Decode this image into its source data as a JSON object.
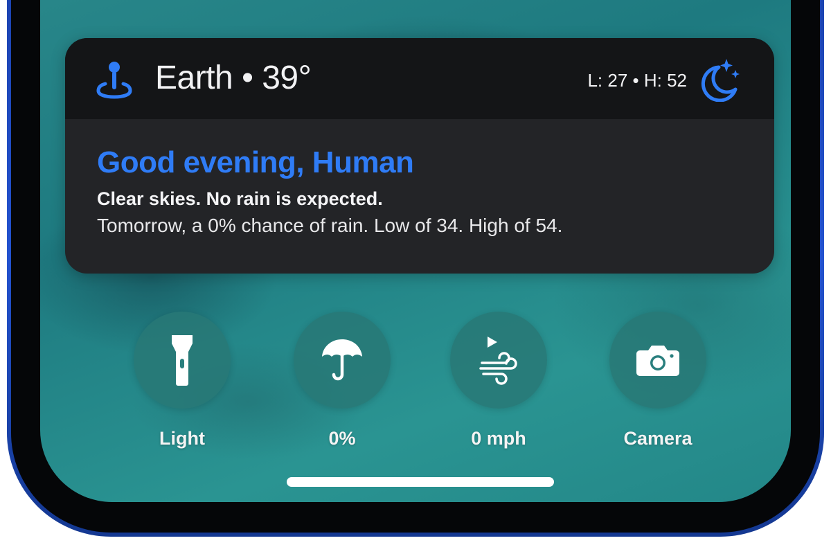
{
  "widget": {
    "location": "Earth • 39°",
    "low_high": "L: 27 • H: 52",
    "greeting": "Good evening, Human",
    "summary": "Clear skies. No rain is expected.",
    "forecast": "Tomorrow, a 0% chance of rain. Low of 34. High of 54.",
    "location_icon": "location-pin-icon",
    "condition_icon": "moon-stars-icon",
    "accent_color": "#2f7cf6"
  },
  "quick_actions": [
    {
      "label": "Light",
      "icon": "flashlight-icon"
    },
    {
      "label": "0%",
      "icon": "umbrella-icon"
    },
    {
      "label": "0 mph",
      "icon": "wind-icon"
    },
    {
      "label": "Camera",
      "icon": "camera-icon"
    }
  ]
}
